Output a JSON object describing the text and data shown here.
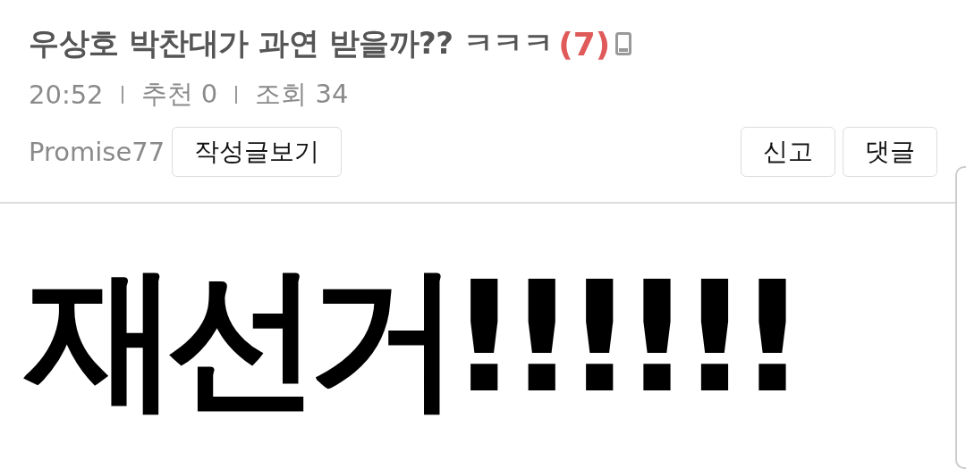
{
  "post": {
    "title": "우상호 박찬대가 과연 받을까?? ㅋㅋㅋ",
    "comment_count": "(7)",
    "meta": [
      {
        "text": "20:52"
      },
      {
        "text": "추천 0"
      },
      {
        "text": "조회 34"
      }
    ],
    "author": "Promise77",
    "actions_left": [
      "작성글보기"
    ],
    "actions_right": [
      "신고",
      "댓글"
    ],
    "body": "재선거!!!!!!"
  }
}
